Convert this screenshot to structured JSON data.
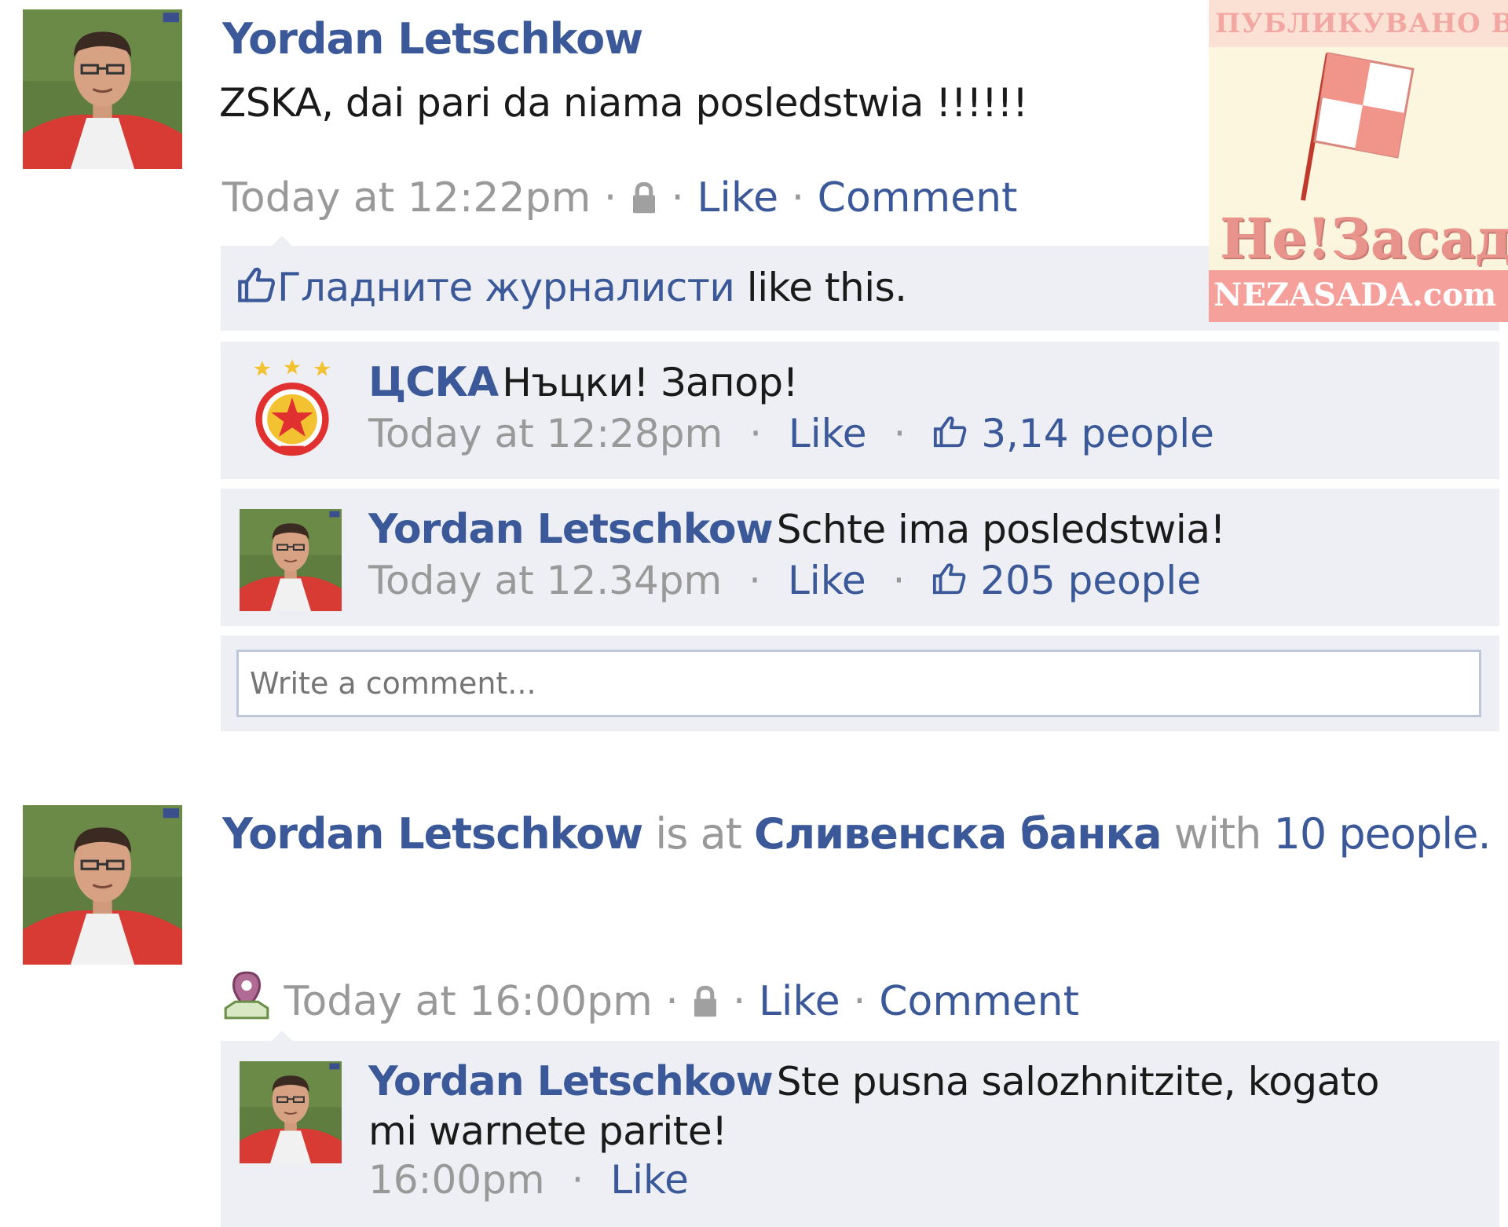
{
  "post1": {
    "author": "Yordan Letschkow",
    "text": "ZSKA, dai pari da niama posledstwia !!!!!!",
    "time": "Today at 12:22pm",
    "sep": "·",
    "like": "Like",
    "comment": "Comment",
    "likes_name": "Гладните журналисти",
    "likes_suffix": " like this.",
    "comments": [
      {
        "author": "ЦСКА",
        "text": "Нъцки! Запор!",
        "time": "Today at 12:28pm",
        "like": "Like",
        "count": "3,14 people"
      },
      {
        "author": "Yordan Letschkow",
        "text": "Schte ima posledstwia!",
        "time": "Today at 12.34pm",
        "like": "Like",
        "count": "205 people"
      }
    ],
    "input_placeholder": "Write a comment..."
  },
  "post2": {
    "author": "Yordan Letschkow",
    "is_at": "is at",
    "place": "Сливенска банка",
    "with": "with",
    "people": "10 people.",
    "time": "Today at 16:00pm",
    "like": "Like",
    "comment": "Comment",
    "comments": [
      {
        "author": "Yordan Letschkow",
        "text_line1": "Ste pusna salozhnitzite, kogato",
        "text_line2": "mi warnete parite!",
        "time": "16:00pm",
        "like": "Like"
      }
    ]
  },
  "watermark": {
    "top": "ПУБЛИКУВАНО В",
    "middle": "Не!Засада",
    "bottom": "NEZASADA.com"
  },
  "colors": {
    "link": "#3b5998",
    "muted": "#999999",
    "block_bg": "#edeff4",
    "input_border": "#bdc7d8"
  },
  "icons": [
    "thumbs-up-icon",
    "lock-icon",
    "location-pin-icon",
    "cska-logo"
  ]
}
